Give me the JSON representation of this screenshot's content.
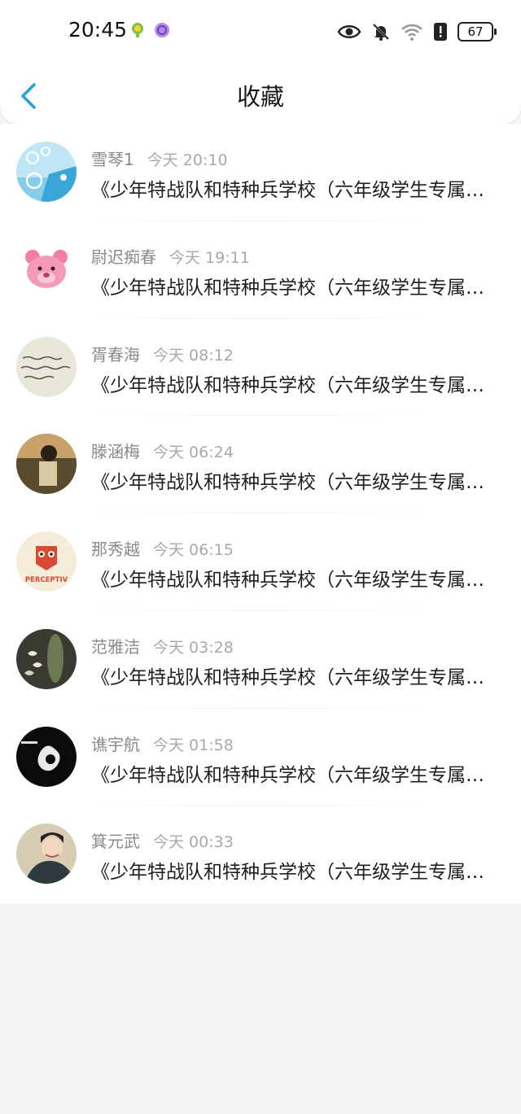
{
  "status_bar": {
    "time": "20:45",
    "battery": "67",
    "icons": [
      "app-notification-icon",
      "app-notification-icon",
      "eye-icon",
      "mute-bell-icon",
      "wifi-icon",
      "alert-icon",
      "battery-icon"
    ]
  },
  "header": {
    "title": "收藏",
    "back_icon": "chevron-left-icon",
    "accent": "#2a9fe0"
  },
  "favorites": [
    {
      "name": "雪琴1",
      "time": "今天 20:10",
      "content": "《少年特战队和特种兵学校（六年级学生专属）》"
    },
    {
      "name": "尉迟痴春",
      "time": "今天 19:11",
      "content": "《少年特战队和特种兵学校（六年级学生专属）》"
    },
    {
      "name": "胥春海",
      "time": "今天 08:12",
      "content": "《少年特战队和特种兵学校（六年级学生专属）》"
    },
    {
      "name": "滕涵梅",
      "time": "今天 06:24",
      "content": "《少年特战队和特种兵学校（六年级学生专属）》"
    },
    {
      "name": "那秀越",
      "time": "今天 06:15",
      "content": "《少年特战队和特种兵学校（六年级学生专属）》"
    },
    {
      "name": "范雅洁",
      "time": "今天 03:28",
      "content": "《少年特战队和特种兵学校（六年级学生专属）》"
    },
    {
      "name": "谯宇航",
      "time": "今天 01:58",
      "content": "《少年特战队和特种兵学校（六年级学生专属）》"
    },
    {
      "name": "箕元武",
      "time": "今天 00:33",
      "content": "《少年特战队和特种兵学校（六年级学生专属）》"
    }
  ],
  "avatar_labels": {
    "owl_logo_text": "PERCEPTIV"
  }
}
